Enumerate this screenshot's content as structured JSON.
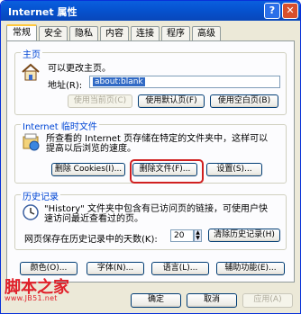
{
  "window": {
    "title": "Internet 属性",
    "help_label": "?",
    "close_label": "✕"
  },
  "tabs": [
    "常规",
    "安全",
    "隐私",
    "内容",
    "连接",
    "程序",
    "高级"
  ],
  "home": {
    "label": "主页",
    "description": "可以更改主页。",
    "address_label": "地址(R):",
    "address_value": "about:blank",
    "use_current": "使用当前页(C)",
    "use_default": "使用默认页(F)",
    "use_blank": "使用空白页(B)"
  },
  "temp_files": {
    "label": "Internet 临时文件",
    "description_line1": "所查看的 Internet 页存储在特定的文件夹中，这样可以",
    "description_line2": "提高以后浏览的速度。",
    "delete_cookies": "删除 Cookies(I)...",
    "delete_files": "删除文件(F)...",
    "settings": "设置(S)..."
  },
  "history": {
    "label": "历史记录",
    "description_line1": "\"History\" 文件夹中包含有已访问页的链接，可使用户快",
    "description_line2": "速访问最近查看过的页。",
    "days_label": "网页保存在历史记录中的天数(K):",
    "days_value": "20",
    "clear": "清除历史记录(H)"
  },
  "bottom_buttons": {
    "colors": "颜色(O)...",
    "fonts": "字体(N)...",
    "languages": "语言(L)...",
    "accessibility": "辅助功能(E)..."
  },
  "dialog_buttons": {
    "ok": "确定",
    "cancel": "取消",
    "apply": "应用(A)"
  },
  "watermark": {
    "text": "脚本之家",
    "url": "www.JB51.net"
  }
}
